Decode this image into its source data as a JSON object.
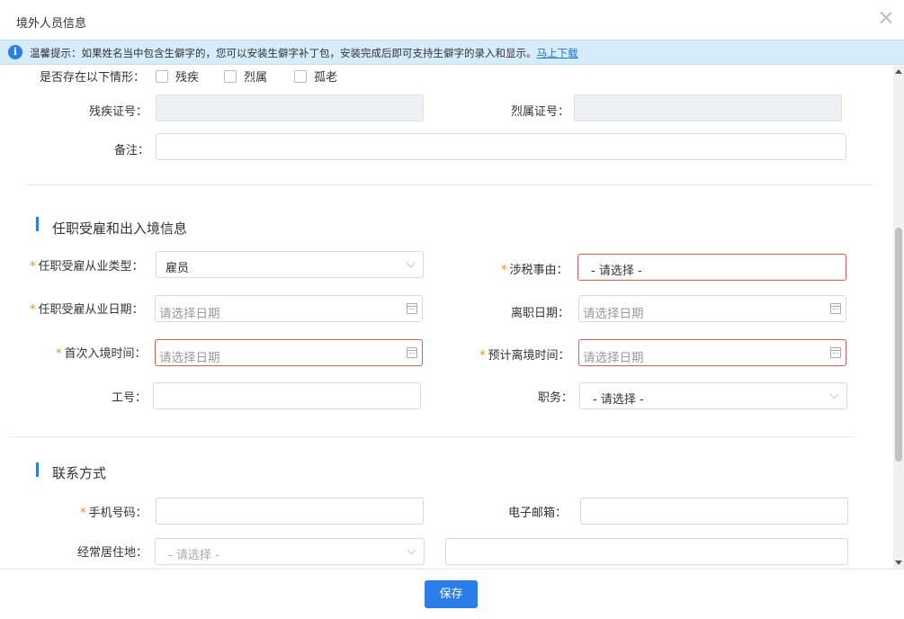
{
  "dialog": {
    "title": "境外人员信息",
    "close_icon": "close-icon"
  },
  "notice": {
    "icon": "info-icon",
    "text": "温馨提示：如果姓名当中包含生僻字的，您可以安装生僻字补丁包，安装完成后即可支持生僻字的录入和显示。",
    "link": "马上下载"
  },
  "situation": {
    "label": "是否存在以下情形：",
    "options": [
      "残疾",
      "烈属",
      "孤老"
    ]
  },
  "fields": {
    "disability_cert": {
      "label": "残疾证号：",
      "value": ""
    },
    "martyr_cert": {
      "label": "烈属证号：",
      "value": ""
    },
    "remark": {
      "label": "备注：",
      "value": ""
    },
    "employment_type": {
      "label": "任职受雇从业类型：",
      "value": "雇员"
    },
    "tax_matter": {
      "label": "涉税事由：",
      "value": "- 请选择 -"
    },
    "employment_date": {
      "label": "任职受雇从业日期：",
      "placeholder": "请选择日期"
    },
    "leave_date": {
      "label": "离职日期：",
      "placeholder": "请选择日期"
    },
    "first_entry_time": {
      "label": "首次入境时间：",
      "placeholder": "请选择日期"
    },
    "expected_departure_time": {
      "label": "预计离境时间：",
      "placeholder": "请选择日期"
    },
    "employee_no": {
      "label": "工号：",
      "value": ""
    },
    "position": {
      "label": "职务：",
      "value": "- 请选择 -"
    },
    "phone": {
      "label": "手机号码：",
      "value": ""
    },
    "email": {
      "label": "电子邮箱：",
      "value": ""
    },
    "residence": {
      "label": "经常居住地：",
      "value": "- 请选择 -",
      "detail": ""
    }
  },
  "sections": {
    "employment": "任职受雇和出入境信息",
    "contact": "联系方式"
  },
  "footer": {
    "save_label": "保存"
  },
  "colors": {
    "accent": "#2b7de9",
    "error_border": "#e05a4f",
    "required": "#f08a24",
    "notice_bg": "#d6ecfb"
  }
}
